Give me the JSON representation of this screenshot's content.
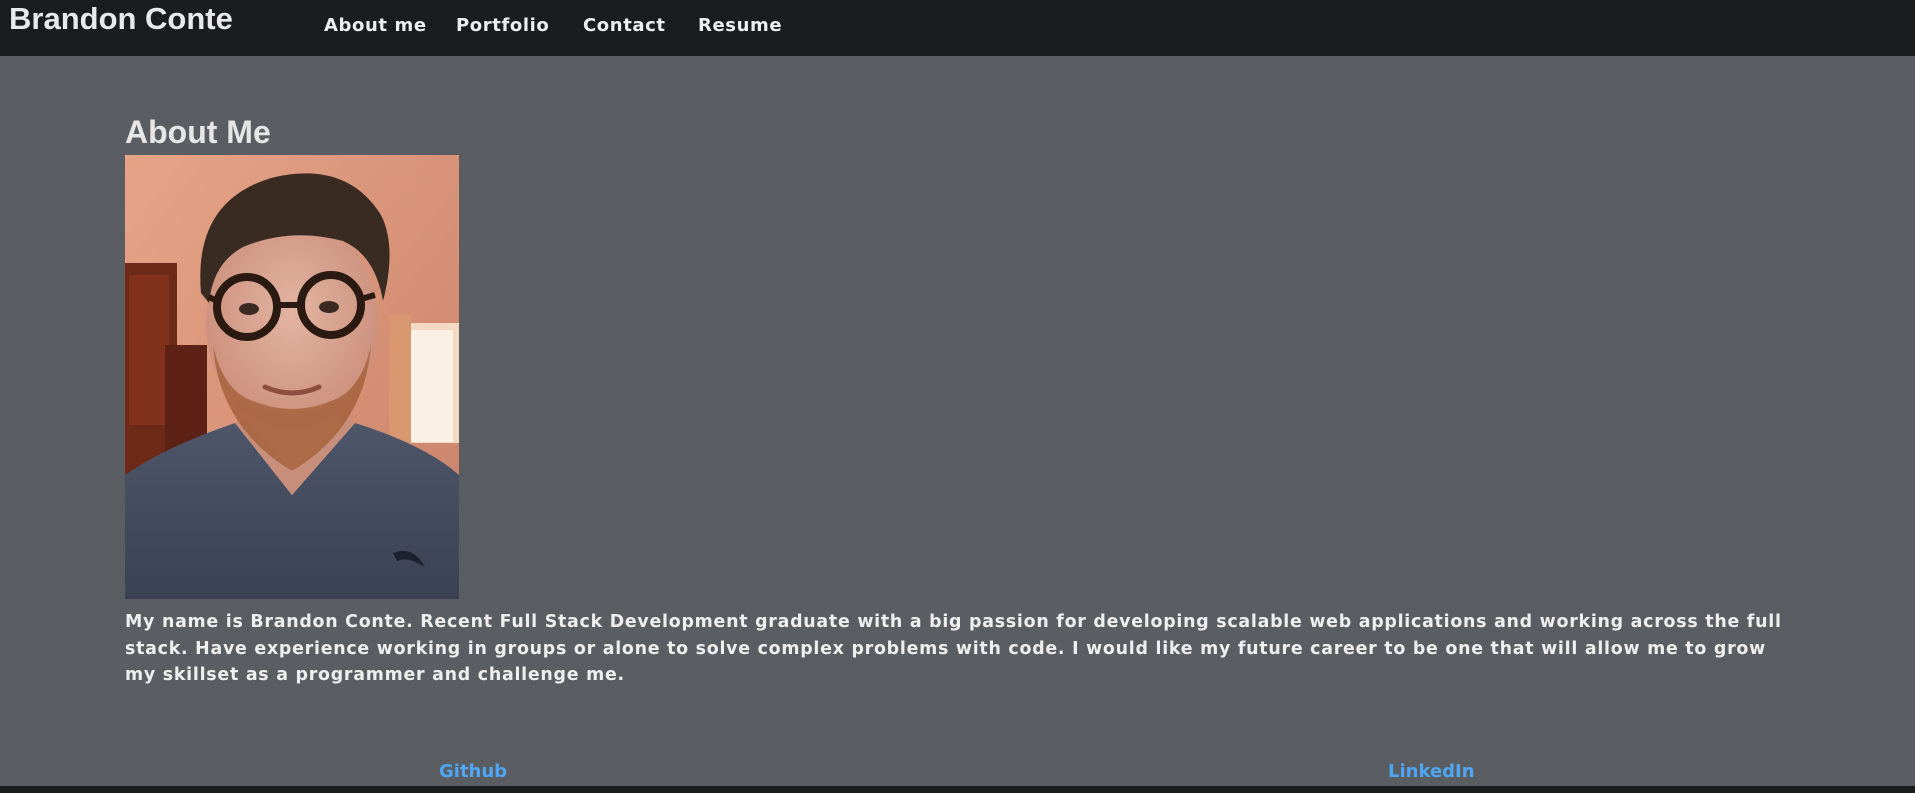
{
  "navbar": {
    "brand": "Brandon Conte",
    "links": [
      "About me",
      "Portfolio",
      "Contact",
      "Resume"
    ]
  },
  "about": {
    "heading": "About Me",
    "photo_alt": "Portrait photo of Brandon Conte",
    "bio": "My name is Brandon Conte. Recent Full Stack Development graduate with a big passion for developing scalable web applications and working across the full stack. Have experience working in groups or alone to solve complex problems with code. I would like my future career to be one that will allow me to grow my skillset as a programmer and challenge me."
  },
  "footer": {
    "links": [
      "Github",
      "LinkedIn"
    ]
  },
  "colors": {
    "navbar_bg": "#1b1c1e",
    "page_bg": "#5a5e62",
    "text": "#eeeeee",
    "link_accent": "#4ea6f5"
  }
}
